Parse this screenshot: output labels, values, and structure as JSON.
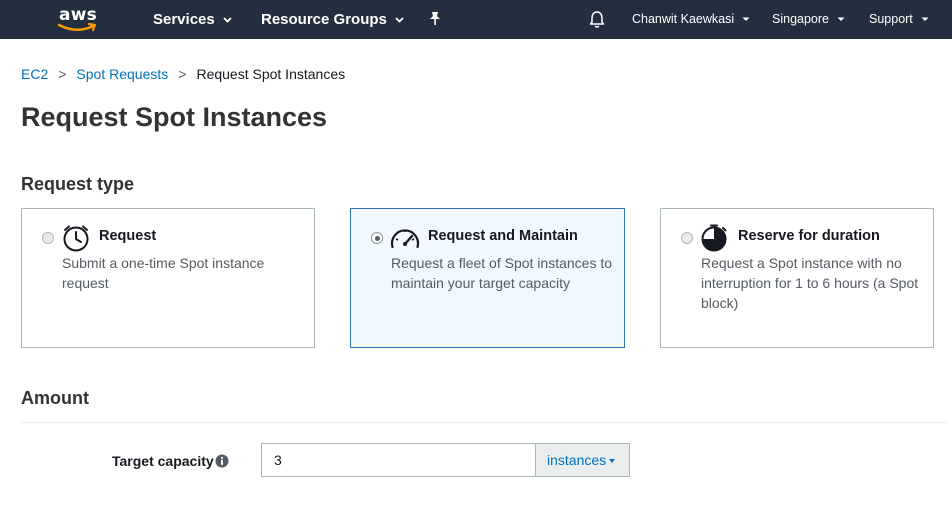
{
  "topnav": {
    "logo_text": "aws",
    "services": "Services",
    "resource_groups": "Resource Groups",
    "user": "Chanwit Kaewkasi",
    "region": "Singapore",
    "support": "Support"
  },
  "breadcrumb": {
    "items": [
      "EC2",
      "Spot Requests",
      "Request Spot Instances"
    ],
    "separator": ">"
  },
  "page": {
    "title": "Request Spot Instances"
  },
  "request_type": {
    "title": "Request type",
    "options": [
      {
        "title": "Request",
        "description": "Submit a one-time Spot instance request",
        "selected": false,
        "icon": "clock-icon"
      },
      {
        "title": "Request and Maintain",
        "description": "Request a fleet of Spot instances to maintain your target capacity",
        "selected": true,
        "icon": "gauge-icon"
      },
      {
        "title": "Reserve for duration",
        "description": "Request a Spot instance with no interruption for 1 to 6 hours (a Spot block)",
        "selected": false,
        "icon": "timer-block-icon"
      }
    ]
  },
  "amount": {
    "title": "Amount",
    "target_capacity": {
      "label": "Target capacity",
      "value": "3",
      "unit": "instances"
    }
  },
  "colors": {
    "nav_bg": "#232f3e",
    "link": "#0073bb",
    "selected_bg": "#f1f8fe",
    "selected_border": "#2e73b8",
    "logo_smile": "#ff9900"
  }
}
